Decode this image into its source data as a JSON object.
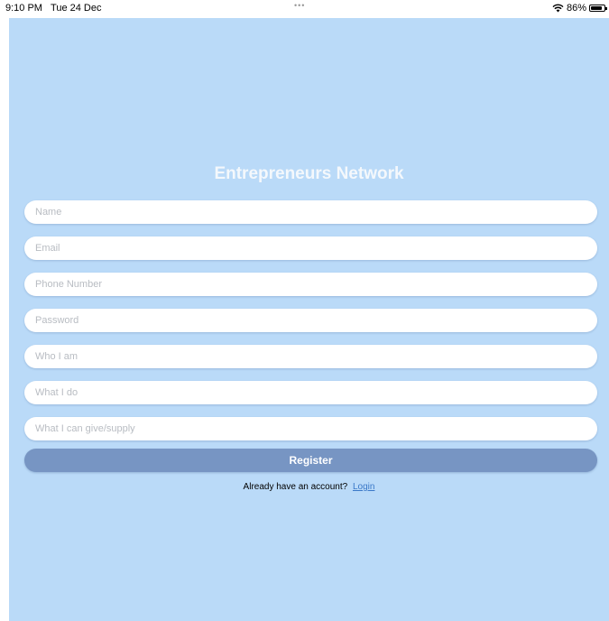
{
  "status_bar": {
    "time": "9:10 PM",
    "date": "Tue 24 Dec",
    "dots": "•••",
    "battery": "86%",
    "icons": [
      "wifi-icon",
      "battery-icon"
    ]
  },
  "app": {
    "title": "Entrepreneurs Network",
    "colors": {
      "background": "#badaf8",
      "button": "#7795c3",
      "link": "#3a78c8"
    }
  },
  "form": {
    "fields": [
      {
        "placeholder": "Name",
        "value": ""
      },
      {
        "placeholder": "Email",
        "value": ""
      },
      {
        "placeholder": "Phone Number",
        "value": ""
      },
      {
        "placeholder": "Password",
        "value": ""
      },
      {
        "placeholder": "Who I am",
        "value": ""
      },
      {
        "placeholder": "What I do",
        "value": ""
      },
      {
        "placeholder": "What I can give/supply",
        "value": ""
      }
    ],
    "register_label": "Register",
    "account_prompt": "Already have an account?",
    "login_label": "Login"
  }
}
